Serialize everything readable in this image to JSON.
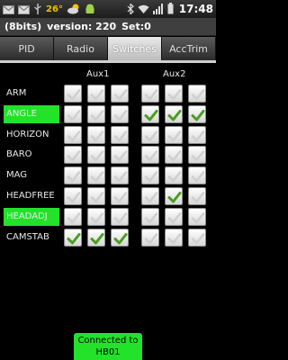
{
  "status_bar": {
    "icons_left": [
      "mail-icon",
      "mail-icon",
      "usb-icon"
    ],
    "temperature": "26°",
    "icons_right": [
      "bluetooth-icon",
      "wifi-icon",
      "signal-icon",
      "battery-icon"
    ],
    "time": "17:48"
  },
  "titlebar": {
    "bits": "(8bits)",
    "version": "version: 220",
    "set": "Set:0"
  },
  "tabs": [
    {
      "label": "PID",
      "active": false
    },
    {
      "label": "Radio",
      "active": false
    },
    {
      "label": "Switches",
      "active": true
    },
    {
      "label": "AccTrim",
      "active": false
    }
  ],
  "aux_headers": [
    "Aux1",
    "Aux2"
  ],
  "rows": [
    {
      "label": "ARM",
      "highlight": false,
      "aux1": [
        false,
        false,
        false
      ],
      "aux2": [
        false,
        false,
        false
      ]
    },
    {
      "label": "ANGLE",
      "highlight": true,
      "aux1": [
        false,
        false,
        false
      ],
      "aux2": [
        true,
        true,
        true
      ]
    },
    {
      "label": "HORIZON",
      "highlight": false,
      "aux1": [
        false,
        false,
        false
      ],
      "aux2": [
        false,
        false,
        false
      ]
    },
    {
      "label": "BARO",
      "highlight": false,
      "aux1": [
        false,
        false,
        false
      ],
      "aux2": [
        false,
        false,
        false
      ]
    },
    {
      "label": "MAG",
      "highlight": false,
      "aux1": [
        false,
        false,
        false
      ],
      "aux2": [
        false,
        false,
        false
      ]
    },
    {
      "label": "HEADFREE",
      "highlight": false,
      "aux1": [
        false,
        false,
        false
      ],
      "aux2": [
        false,
        true,
        false
      ]
    },
    {
      "label": "HEADADJ",
      "highlight": true,
      "aux1": [
        false,
        false,
        false
      ],
      "aux2": [
        false,
        false,
        false
      ]
    },
    {
      "label": "CAMSTAB",
      "highlight": false,
      "aux1": [
        true,
        true,
        true
      ],
      "aux2": [
        false,
        false,
        false
      ]
    }
  ],
  "connection": {
    "line1": "Connected to",
    "line2": "HB01"
  },
  "colors": {
    "highlight": "#22e22a",
    "check": "#4a9e20",
    "bg": "#000000"
  }
}
